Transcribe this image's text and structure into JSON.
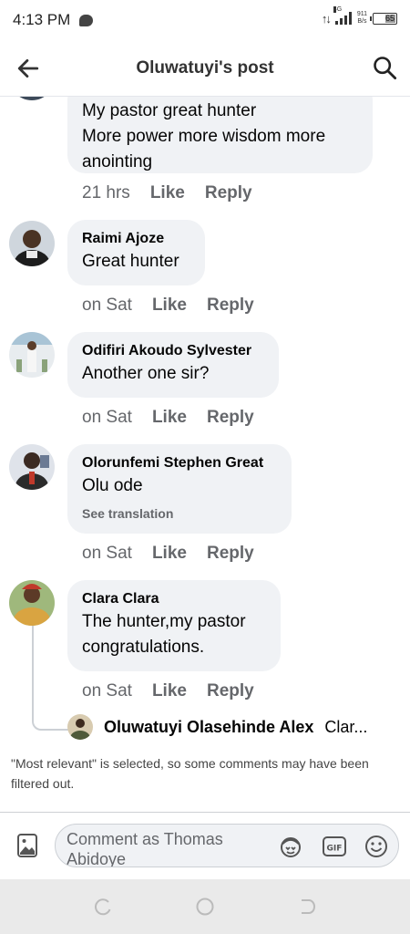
{
  "status_bar": {
    "time": "4:13 PM",
    "network": "4G",
    "speed_value": "911",
    "speed_unit": "B/s",
    "battery": "65"
  },
  "header": {
    "title": "Oluwatuyi's post",
    "back_icon": "arrow-left-icon",
    "search_icon": "search-icon"
  },
  "comments": [
    {
      "author": "",
      "lines": [
        "My pastor great hunter",
        "More power more wisdom more anointing"
      ],
      "time": "21 hrs",
      "like_label": "Like",
      "reply_label": "Reply"
    },
    {
      "author": "Raimi Ajoze",
      "text": "Great hunter",
      "time": "on Sat",
      "like_label": "Like",
      "reply_label": "Reply"
    },
    {
      "author": "Odifiri Akoudo Sylvester",
      "text": "Another one sir?",
      "time": "on Sat",
      "like_label": "Like",
      "reply_label": "Reply"
    },
    {
      "author": "Olorunfemi Stephen Great",
      "text": "Olu ode",
      "see_translation": "See translation",
      "time": "on Sat",
      "like_label": "Like",
      "reply_label": "Reply"
    },
    {
      "author": "Clara Clara",
      "lines": [
        "The hunter,my pastor",
        "congratulations."
      ],
      "time": "on Sat",
      "like_label": "Like",
      "reply_label": "Reply",
      "reply_preview": {
        "author": "Oluwatuyi Olasehinde Alex",
        "snippet": "Clar..."
      }
    }
  ],
  "filter_note": "\"Most relevant\" is selected, so some comments may have been filtered out.",
  "composer": {
    "placeholder": "Comment as Thomas Abidoye",
    "icons": [
      "photo-icon",
      "avatar-sticker-icon",
      "gif-icon",
      "emoji-icon"
    ],
    "gif_label": "GIF"
  },
  "nav_bar": {
    "icons": [
      "recent-apps-icon",
      "home-icon",
      "back-icon"
    ]
  },
  "colors": {
    "bubble": "#f0f2f5",
    "meta_text": "#65676b",
    "nav_bar": "#eaeaea"
  }
}
